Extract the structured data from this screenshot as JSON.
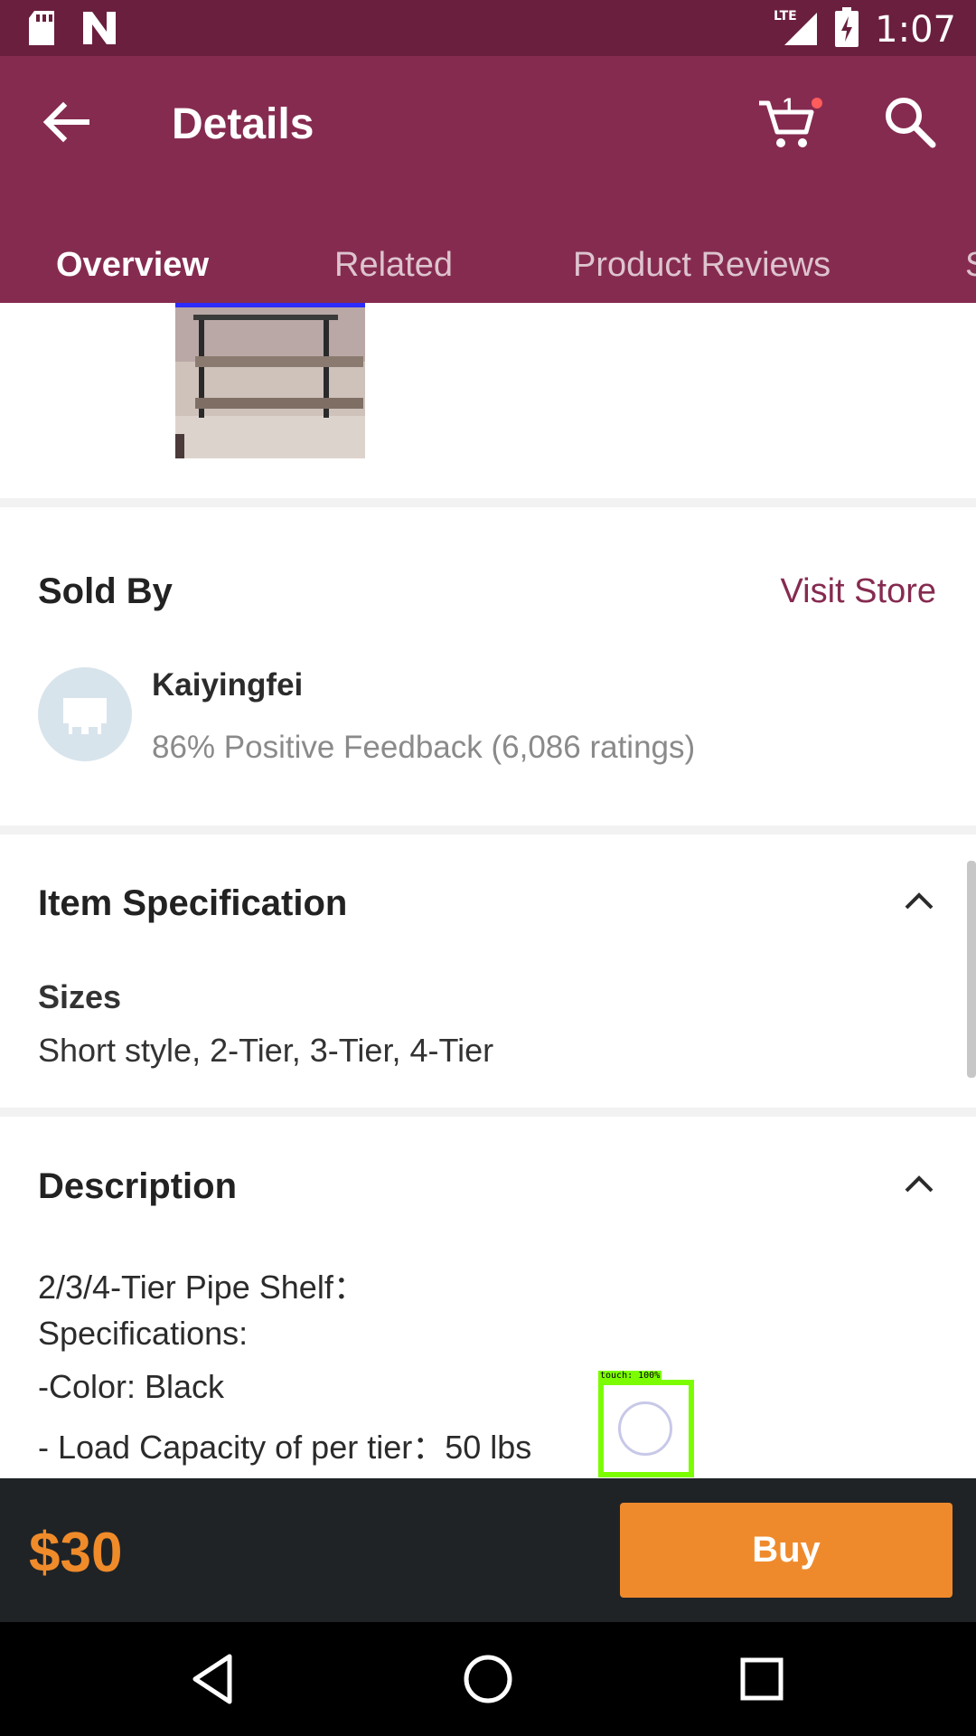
{
  "status_bar": {
    "time": "1:07",
    "network": "LTE",
    "icons": [
      "sd-card-icon",
      "n-notification-icon",
      "lte-signal-icon",
      "battery-charging-icon"
    ]
  },
  "app_bar": {
    "title": "Details",
    "cart_count": "1",
    "icons": {
      "back": "arrow-back-icon",
      "cart": "cart-icon",
      "search": "search-icon"
    }
  },
  "tabs": [
    {
      "label": "Overview",
      "active": true
    },
    {
      "label": "Related",
      "active": false
    },
    {
      "label": "Product Reviews",
      "active": false
    },
    {
      "label": "S",
      "active": false
    }
  ],
  "seller": {
    "section_title": "Sold By",
    "visit_store_label": "Visit Store",
    "name": "Kaiyingfei",
    "feedback": "86% Positive Feedback (6,086 ratings)"
  },
  "item_spec": {
    "section_title": "Item Specification",
    "label": "Sizes",
    "value": "Short style, 2-Tier, 3-Tier, 4-Tier"
  },
  "description": {
    "section_title": "Description",
    "lines": [
      "2/3/4-Tier Pipe Shelf：",
      "Specifications:",
      "-Color: Black",
      "- Load Capacity of per tier：50 lbs"
    ]
  },
  "touch_overlay": {
    "label": "touch: 100%"
  },
  "buy_bar": {
    "price": "$30",
    "buy_label": "Buy"
  },
  "colors": {
    "brand": "#862b50",
    "status_bar": "#6a1f3e",
    "accent_orange": "#ef8a2c",
    "buy_bar_bg": "#1f2326"
  }
}
